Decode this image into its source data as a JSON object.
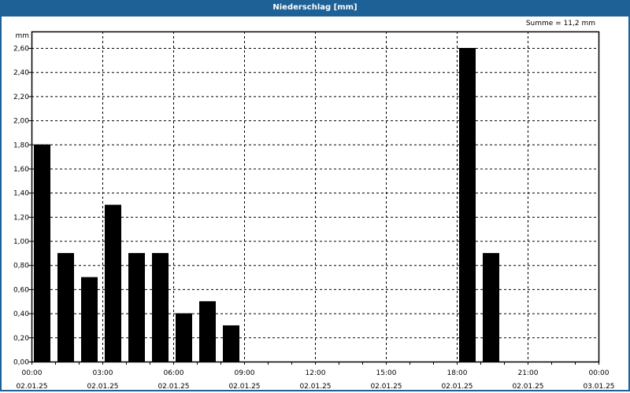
{
  "title": "Niederschlag [mm]",
  "summary": "Summe = 11,2 mm",
  "chart_data": {
    "type": "bar",
    "title": "Niederschlag [mm]",
    "ylabel": "mm",
    "xlabel": "",
    "ylim": [
      0,
      2.6
    ],
    "yticks": [
      "0,00",
      "0,20",
      "0,40",
      "0,60",
      "0,80",
      "1,00",
      "1,20",
      "1,40",
      "1,60",
      "1,80",
      "2,00",
      "2,20",
      "2,40",
      "2,60"
    ],
    "xlim_hours": [
      0,
      24
    ],
    "xticks": [
      {
        "time": "00:00",
        "date": "02.01.25"
      },
      {
        "time": "03:00",
        "date": "02.01.25"
      },
      {
        "time": "06:00",
        "date": "02.01.25"
      },
      {
        "time": "09:00",
        "date": "02.01.25"
      },
      {
        "time": "12:00",
        "date": "02.01.25"
      },
      {
        "time": "15:00",
        "date": "02.01.25"
      },
      {
        "time": "18:00",
        "date": "02.01.25"
      },
      {
        "time": "21:00",
        "date": "02.01.25"
      },
      {
        "time": "00:00",
        "date": "03.01.25"
      }
    ],
    "bars": [
      {
        "hour": 0,
        "value": 1.8
      },
      {
        "hour": 1,
        "value": 0.9
      },
      {
        "hour": 2,
        "value": 0.7
      },
      {
        "hour": 3,
        "value": 1.3
      },
      {
        "hour": 4,
        "value": 0.9
      },
      {
        "hour": 5,
        "value": 0.9
      },
      {
        "hour": 6,
        "value": 0.4
      },
      {
        "hour": 7,
        "value": 0.5
      },
      {
        "hour": 8,
        "value": 0.3
      },
      {
        "hour": 18,
        "value": 2.6
      },
      {
        "hour": 19,
        "value": 0.9
      }
    ],
    "total": 11.2,
    "bar_color": "#000000",
    "grid": true
  }
}
